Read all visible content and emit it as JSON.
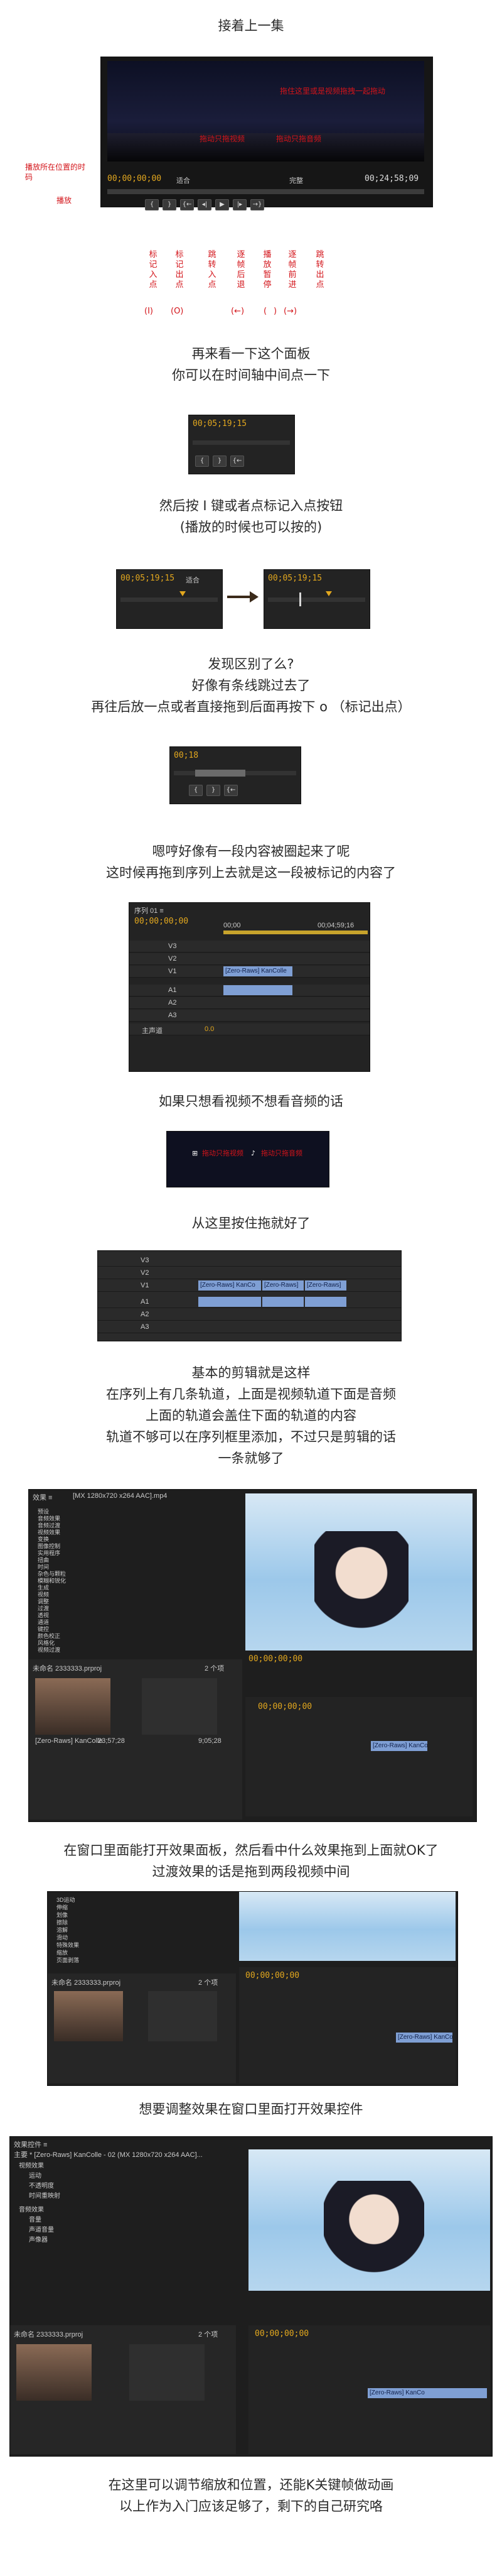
{
  "captions": {
    "c0": "接着上一集",
    "c1": "再来看一下这个面板",
    "c2": "你可以在时间轴中间点一下",
    "c3": "然后按 I 键或者点标记入点按钮",
    "c4": "(播放的时候也可以按的)",
    "c5": "发现区别了么?",
    "c6": "好像有条线跳过去了",
    "c7": "再往后放一点或者直接拖到后面再按下 o （标记出点）",
    "c8": "嗯哼好像有一段内容被圈起来了呢",
    "c9": "这时候再拖到序列上去就是这一段被标记的内容了",
    "c10": "如果只想看视频不想看音频的话",
    "c11": "从这里按住拖就好了",
    "c12": "基本的剪辑就是这样",
    "c13": "在序列上有几条轨道，上面是视频轨道下面是音频",
    "c14": "上面的轨道会盖住下面的轨道的内容",
    "c15": "轨道不够可以在序列框里添加，不过只是剪辑的话",
    "c16": "一条就够了",
    "c17": "在窗口里面能打开效果面板，然后看中什么效果拖到上面就OK了",
    "c18": "过渡效果的话是拖到两段视频中间",
    "c19": "想要调整效果在窗口里面打开效果控件",
    "c20": "在这里可以调节缩放和位置，还能K关键帧做动画",
    "c21": "以上作为入门应该足够了，剩下的自己研究咯"
  },
  "annotations": {
    "drag_video": "拖住这里或是视频拖拽一起拖动",
    "drag_video_only": "拖动只拖视频",
    "drag_audio_only": "拖动只拖音频",
    "playhead_pos": "播放所在位置的时码",
    "playhead": "播放",
    "btn_mark_in": "标记入点",
    "btn_mark_out": "标记出点",
    "btn_goto_in": "跳转入点",
    "btn_step_back": "逐帧后退",
    "btn_play": "播放暂停",
    "btn_step_fwd": "逐帧前进",
    "btn_goto_out": "跳转出点",
    "key_in": "(I)",
    "key_out": "(O)",
    "key_left": "(←)",
    "key_space": "(",
    "key_space2": ")",
    "key_right": "(→)"
  },
  "monitor": {
    "timecode": "00;00;00;00",
    "fit": "适合",
    "full": "完整",
    "duration": "00;24;58;09"
  },
  "snips": {
    "tc1": "00;05;19;15",
    "tc2": "00;05;19;15",
    "tc3": "00;05;19;15",
    "tc4": "00;18",
    "fit": "适合"
  },
  "sequence": {
    "tab": "序列 01 ≡",
    "timecode": "00;00;00;00",
    "ruler_start": "00;00",
    "ruler_end": "00;04;59;16",
    "tracks_video": [
      "V3",
      "V2",
      "V1"
    ],
    "tracks_audio": [
      "A1",
      "A2",
      "A3"
    ],
    "clip_video": "[Zero-Raws] KanColle",
    "clip_audio": "",
    "master": "主声道",
    "master_val": "0.0"
  },
  "seq2": {
    "clip1": "[Zero-Raws] KanCo",
    "clip2": "[Zero-Raws]",
    "clip3": "[Zero-Raws]"
  },
  "effects": {
    "tab": "效果 ≡",
    "tab2": "[MX 1280x720 x264 AAC].mp4",
    "items": [
      "预设",
      "音频效果",
      "音频过渡",
      "视频效果",
      "变换",
      "图像控制",
      "实用程序",
      "扭曲",
      "时间",
      "杂色与颗粒",
      "模糊和锐化",
      "生成",
      "视频",
      "调整",
      "过渡",
      "透视",
      "通道",
      "键控",
      "颜色校正",
      "风格化",
      "视频过渡"
    ],
    "sub": [
      "3D运动",
      "伸缩",
      "划像",
      "擦除",
      "溶解",
      "滑动",
      "特殊效果",
      "缩放",
      "页面剥落"
    ],
    "project": "未命名.prproj",
    "items_count": "2 个项",
    "bin_label": "未命名 2333333.prproj",
    "media": "[Zero-Raws] KanColle",
    "dur1": "23;57;28",
    "dur2": "9;05;28"
  },
  "effect_controls": {
    "tab": "效果控件 ≡",
    "source": "主要 * [Zero-Raws] KanColle - 02 (MX 1280x720 x264 AAC]...",
    "fx1": "视频效果",
    "fx2": "运动",
    "fx3": "不透明度",
    "fx4": "时间重映射",
    "fx5": "音频效果",
    "fx6": "音量",
    "fx7": "声道音量",
    "fx8": "声像器"
  },
  "colors": {
    "accent_red": "#d3141a",
    "timecode_amber": "#e2a71e",
    "clip_blue": "#7f9fd4",
    "panel_dark": "#232323"
  }
}
